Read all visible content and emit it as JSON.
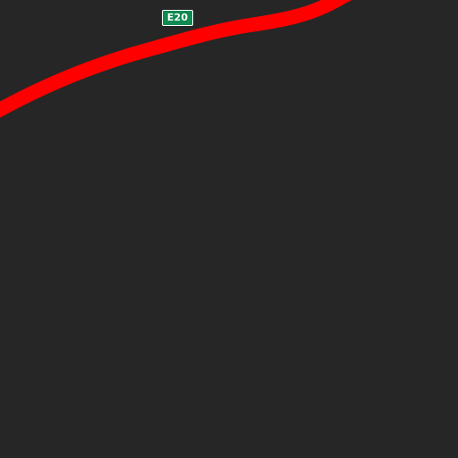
{
  "map": {
    "background_color": "#262626",
    "road": {
      "color": "#ff0000",
      "route_ref": "E20"
    },
    "route_shield": {
      "label": "E20",
      "background_color": "#0f8a50",
      "text_color": "#ffffff"
    }
  }
}
